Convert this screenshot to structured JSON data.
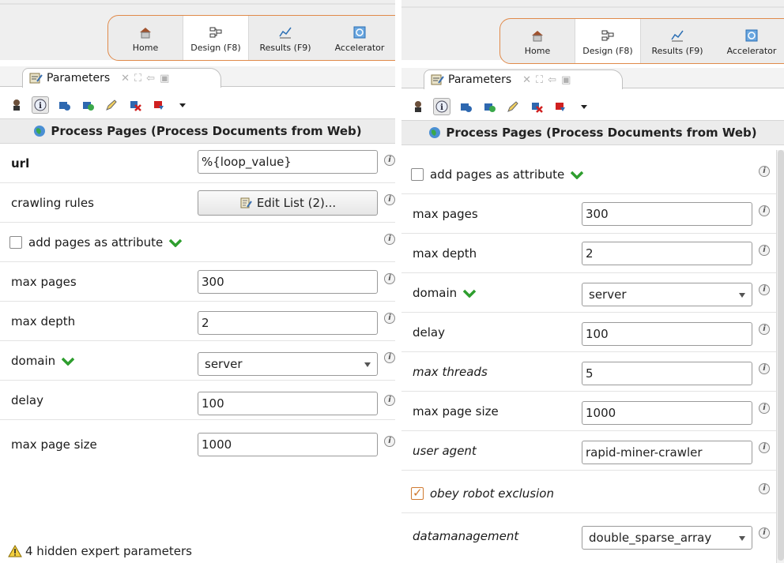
{
  "perspectives": {
    "home": "Home",
    "design": "Design (F8)",
    "results": "Results (F9)",
    "accelerator": "Accelerator"
  },
  "panel": {
    "tab_label": "Parameters",
    "title": "Process Pages (Process Documents from Web)"
  },
  "left": {
    "url_label": "url",
    "url_value": "%{loop_value}",
    "crawling_rules_label": "crawling rules",
    "crawling_rules_button": "Edit List (2)...",
    "add_pages_label": "add pages as attribute",
    "max_pages_label": "max pages",
    "max_pages_value": "300",
    "max_depth_label": "max depth",
    "max_depth_value": "2",
    "domain_label": "domain",
    "domain_value": "server",
    "delay_label": "delay",
    "delay_value": "100",
    "max_page_size_label": "max page size",
    "max_page_size_value": "1000",
    "hidden_notice": "4 hidden expert parameters"
  },
  "right": {
    "add_pages_label": "add pages as attribute",
    "max_pages_label": "max pages",
    "max_pages_value": "300",
    "max_depth_label": "max depth",
    "max_depth_value": "2",
    "domain_label": "domain",
    "domain_value": "server",
    "delay_label": "delay",
    "delay_value": "100",
    "max_threads_label": "max threads",
    "max_threads_value": "5",
    "max_page_size_label": "max page size",
    "max_page_size_value": "1000",
    "user_agent_label": "user agent",
    "user_agent_value": "rapid-miner-crawler",
    "obey_robot_label": "obey robot exclusion",
    "datamanagement_label": "datamanagement",
    "datamanagement_value": "double_sparse_array"
  },
  "colors": {
    "accent_border": "#e08a4a",
    "check_green": "#2e9e2e",
    "checkbox_orange": "#d07a30"
  }
}
